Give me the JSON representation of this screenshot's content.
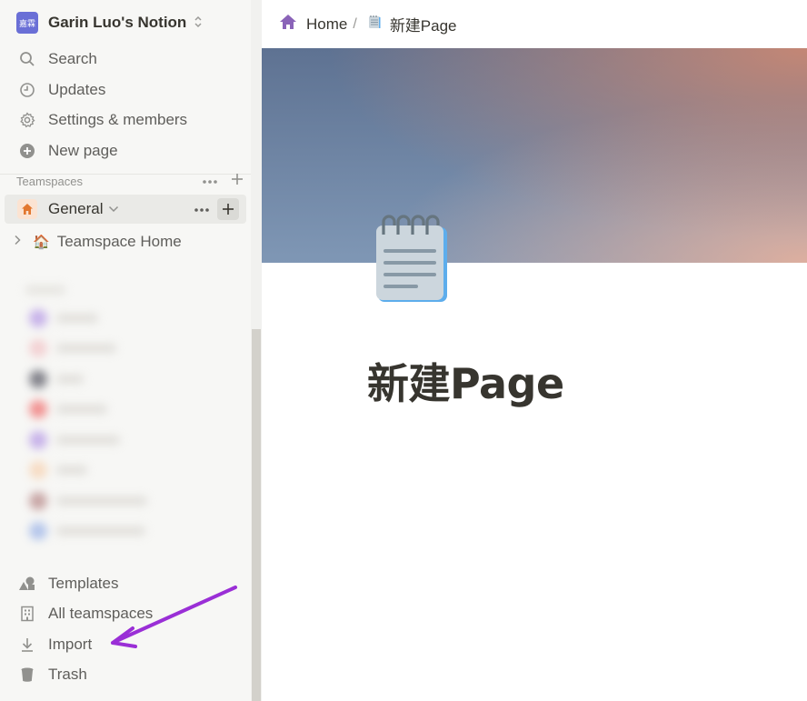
{
  "workspace": {
    "avatar_text": "嘉霖",
    "name": "Garin Luo's Notion"
  },
  "nav": {
    "search": "Search",
    "updates": "Updates",
    "settings": "Settings & members",
    "new_page": "New page"
  },
  "teamspaces": {
    "section_label": "Teamspaces",
    "general": "General",
    "home_icon": "🏠",
    "home_label": "Teamspace Home"
  },
  "bottom": {
    "templates": "Templates",
    "all_teamspaces": "All teamspaces",
    "import": "Import",
    "trash": "Trash"
  },
  "breadcrumb": {
    "home": "Home",
    "separator": "/",
    "page": "新建Page"
  },
  "page": {
    "title": "新建Page",
    "icon": "notepad-icon"
  },
  "colors": {
    "sidebar_bg": "#f7f7f5",
    "accent_purple": "#9a2fd6",
    "home_icon": "#8a63b8",
    "general_icon": "#e2772f"
  }
}
